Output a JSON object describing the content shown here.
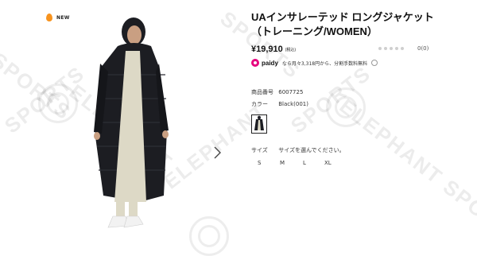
{
  "badge": {
    "label": "NEW"
  },
  "watermark": {
    "text_sports": "SPORTS",
    "text_elephant": "ELEPHANT",
    "text_elephant_sports": "ELEPHANT SPORTS"
  },
  "product": {
    "title_line1": "UAインサレーテッド ロングジャケット",
    "title_line2": "（トレーニング/WOMEN）",
    "price": "¥19,910",
    "tax_note": "(税込)",
    "rating_count": "0(0)"
  },
  "paidy": {
    "brand": "paidy",
    "text": "なら月々3,318円から、分割手数料無料"
  },
  "specs": {
    "product_number_label": "商品番号",
    "product_number": "6007725",
    "color_label": "カラー",
    "color_value": "Black(001)"
  },
  "size": {
    "label": "サイズ",
    "prompt": "サイズを選んでください。",
    "options": [
      "S",
      "M",
      "L",
      "XL"
    ]
  },
  "colors": {
    "accent_flame": "#f7931e",
    "paidy": "#e6007e",
    "jacket": "#1c1d22",
    "dress": "#ddd9c6"
  }
}
